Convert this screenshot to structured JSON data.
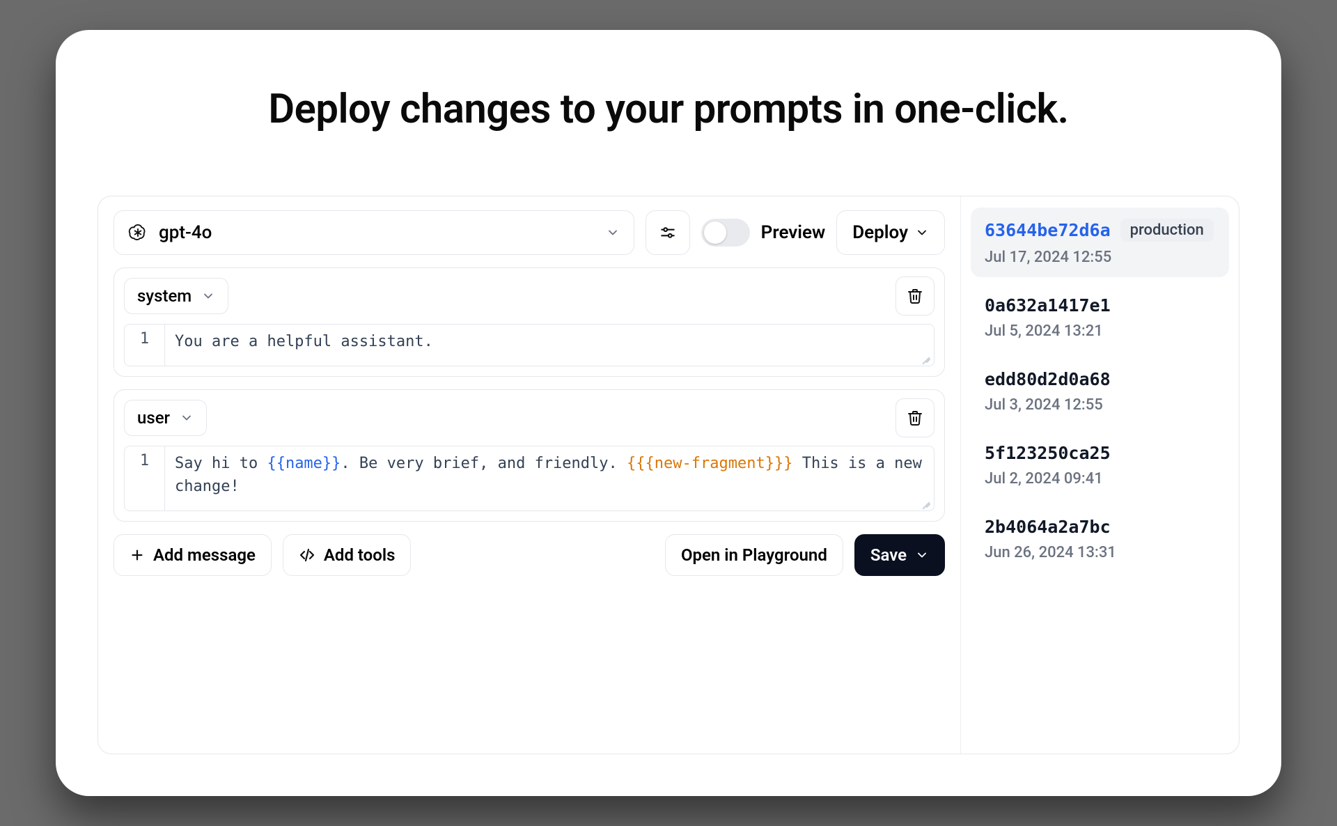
{
  "headline": "Deploy changes to your prompts in one-click.",
  "top": {
    "model": "gpt-4o",
    "preview_label": "Preview",
    "deploy_label": "Deploy"
  },
  "messages": [
    {
      "role": "system",
      "line_no": "1",
      "segments": [
        {
          "t": "plain",
          "text": "You are a helpful assistant."
        }
      ]
    },
    {
      "role": "user",
      "line_no": "1",
      "segments": [
        {
          "t": "plain",
          "text": "Say hi to "
        },
        {
          "t": "var",
          "text": "{{name}}"
        },
        {
          "t": "plain",
          "text": ". Be very brief, and friendly. "
        },
        {
          "t": "frag",
          "text": "{{{new-fragment}}}"
        },
        {
          "t": "plain",
          "text": " This is a new change!"
        }
      ]
    }
  ],
  "buttons": {
    "add_message": "Add message",
    "add_tools": "Add tools",
    "open_playground": "Open in Playground",
    "save": "Save"
  },
  "versions": [
    {
      "hash": "63644be72d6a",
      "tag": "production",
      "date": "Jul 17, 2024 12:55",
      "active": true
    },
    {
      "hash": "0a632a1417e1",
      "tag": null,
      "date": "Jul 5, 2024 13:21",
      "active": false
    },
    {
      "hash": "edd80d2d0a68",
      "tag": null,
      "date": "Jul 3, 2024 12:55",
      "active": false
    },
    {
      "hash": "5f123250ca25",
      "tag": null,
      "date": "Jul 2, 2024 09:41",
      "active": false
    },
    {
      "hash": "2b4064a2a7bc",
      "tag": null,
      "date": "Jun 26, 2024 13:31",
      "active": false
    }
  ]
}
